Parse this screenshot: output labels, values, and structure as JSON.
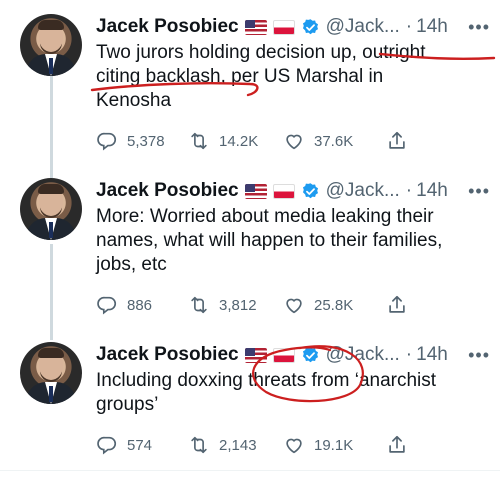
{
  "tweets": [
    {
      "author": "Jacek Posobiec",
      "handle": "@Jack...",
      "separator": "·",
      "time": "14h",
      "text_lines": [
        "Two jurors holding decision up, outright",
        "citing backlash, per US Marshal in",
        "Kenosha"
      ],
      "replies": "5,378",
      "retweets": "14.2K",
      "likes": "37.6K"
    },
    {
      "author": "Jacek Posobiec",
      "handle": "@Jack...",
      "separator": "·",
      "time": "14h",
      "text_lines": [
        "More: Worried about media leaking their",
        "names, what will happen to their families,",
        "jobs, etc"
      ],
      "replies": "886",
      "retweets": "3,812",
      "likes": "25.8K"
    },
    {
      "author": "Jacek Posobiec",
      "handle": "@Jack...",
      "separator": "·",
      "time": "14h",
      "text_lines": [
        "Including doxxing threats from ‘anarchist",
        "groups’"
      ],
      "replies": "574",
      "retweets": "2,143",
      "likes": "19.1K"
    }
  ],
  "icons": {
    "flags": [
      "us-flag-icon",
      "poland-flag-icon"
    ],
    "verified": "verified-badge-icon",
    "more": "more-options-icon",
    "actions": [
      "reply-icon",
      "retweet-icon",
      "like-icon",
      "share-icon"
    ]
  },
  "colors": {
    "text": "#0f1419",
    "secondary": "#536471",
    "verified": "#1d9bf0",
    "annotation": "#cc1f1f",
    "thread_line": "#cfd9de"
  }
}
